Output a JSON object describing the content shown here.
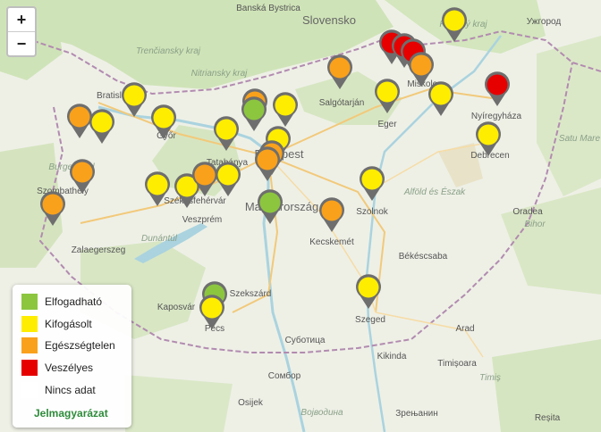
{
  "zoom": {
    "in": "+",
    "out": "−"
  },
  "colors": {
    "Elfogadható": "#8cc63f",
    "Kifogásolt": "#ffed00",
    "Egészségtelen": "#f9a11b",
    "Veszélyes": "#e60000",
    "Nincs adat": "#ffffff"
  },
  "legend": {
    "items": [
      {
        "label": "Elfogadható",
        "color": "#8cc63f"
      },
      {
        "label": "Kifogásolt",
        "color": "#ffed00"
      },
      {
        "label": "Egészségtelen",
        "color": "#f9a11b"
      },
      {
        "label": "Veszélyes",
        "color": "#e60000"
      },
      {
        "label": "Nincs adat",
        "color": "#ffffff"
      }
    ],
    "link": "Jelmagyarázat"
  },
  "labels": [
    "Banská Bystrica",
    "Slovensko",
    "Košický kraj",
    "Ужгород",
    "Trenčiansky kraj",
    "Nitriansky kraj",
    "Bratislava",
    "Győr",
    "Salgótarján",
    "Eger",
    "Miskolc",
    "Nyíregyháza",
    "Satu Mare",
    "Tatabánya",
    "Budapest",
    "Debrecen",
    "Burgenland",
    "Szombathely",
    "Székesfehérvár",
    "Magyarország",
    "Veszprém",
    "Szolnok",
    "Alföld és Észak",
    "Oradea",
    "Bihor",
    "Dunántúl",
    "Kecskemét",
    "Zalaegerszeg",
    "Békéscsaba",
    "Szekszárd",
    "Kaposvár",
    "Pécs",
    "Szeged",
    "Arad",
    "Суботица",
    "Kikinda",
    "Timișoara",
    "Сомбор",
    "Osijek",
    "Војводина",
    "Зрењанин",
    "Timiș",
    "Reșita"
  ]
}
